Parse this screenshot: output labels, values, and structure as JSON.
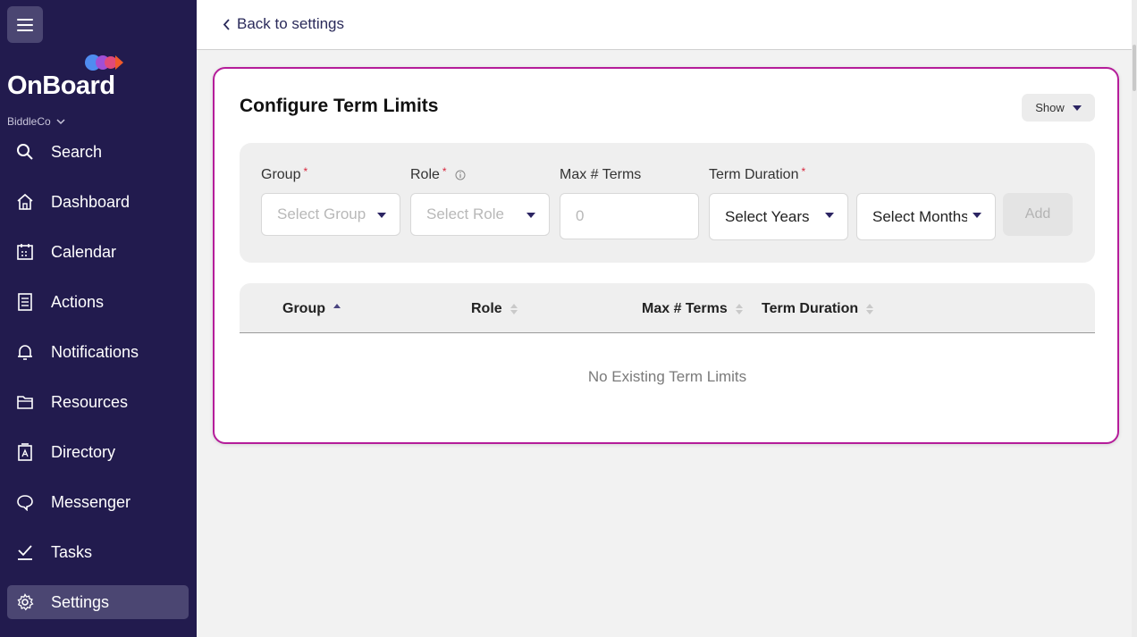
{
  "sidebar": {
    "logo_text": "OnBoard",
    "org_name": "BiddleCo",
    "items": [
      {
        "label": "Search",
        "icon": "search-icon"
      },
      {
        "label": "Dashboard",
        "icon": "home-icon"
      },
      {
        "label": "Calendar",
        "icon": "calendar-icon"
      },
      {
        "label": "Actions",
        "icon": "document-list-icon"
      },
      {
        "label": "Notifications",
        "icon": "bell-icon"
      },
      {
        "label": "Resources",
        "icon": "folder-icon"
      },
      {
        "label": "Directory",
        "icon": "contact-book-icon"
      },
      {
        "label": "Messenger",
        "icon": "chat-bubble-icon"
      },
      {
        "label": "Tasks",
        "icon": "checkmark-icon"
      },
      {
        "label": "Settings",
        "icon": "gear-icon",
        "active": true
      }
    ]
  },
  "header": {
    "back_label": "Back to settings"
  },
  "panel": {
    "title": "Configure Term Limits",
    "show_label": "Show",
    "form": {
      "group_label": "Group",
      "group_placeholder": "Select Group",
      "role_label": "Role",
      "role_placeholder": "Select Role",
      "max_terms_label": "Max # Terms",
      "max_terms_placeholder": "0",
      "term_duration_label": "Term Duration",
      "years_value": "Select Years",
      "months_value": "Select Months",
      "add_label": "Add"
    },
    "table": {
      "columns": [
        "Group",
        "Role",
        "Max # Terms",
        "Term Duration"
      ],
      "empty_text": "No Existing Term Limits"
    }
  },
  "colors": {
    "sidebar_bg": "#221b4e",
    "accent_border": "#b51d9a",
    "required": "#d7263d"
  }
}
